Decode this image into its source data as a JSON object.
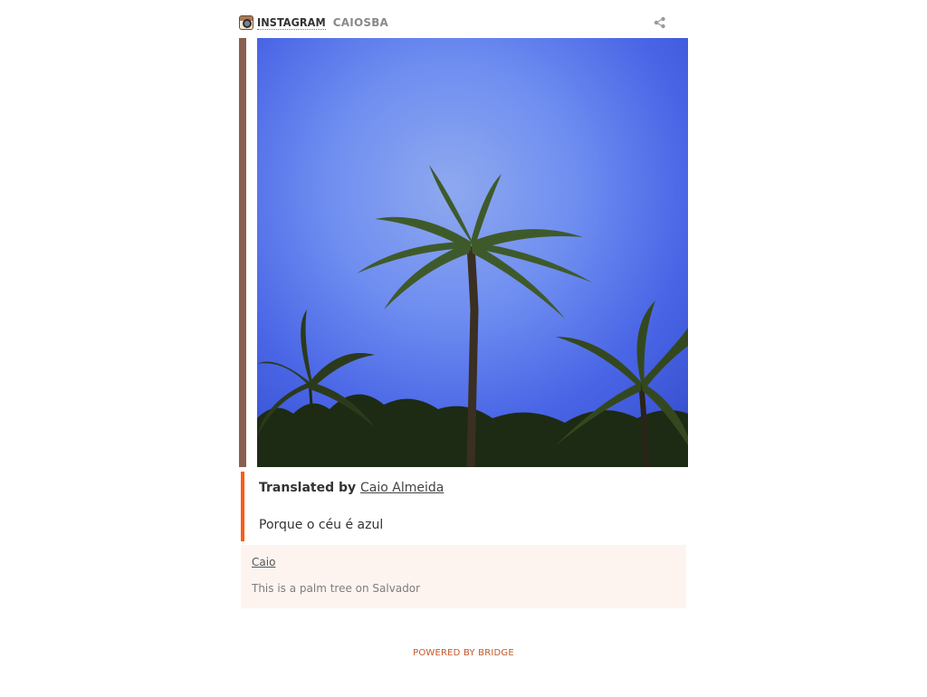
{
  "header": {
    "source_label": "INSTAGRAM",
    "username": "CAIOSBA",
    "share_icon": "share-icon"
  },
  "photo": {
    "alt": "Palm trees against a blue sky"
  },
  "translation": {
    "prefix": "Translated by",
    "translator": "Caio Almeida",
    "text": "Porque o céu é azul"
  },
  "comment": {
    "author": "Caio",
    "text": "This is a palm tree on Salvador"
  },
  "footer": {
    "powered": "POWERED BY BRIDGE"
  },
  "colors": {
    "accent_orange": "#ff5a16",
    "left_bar": "#8a5f51",
    "comment_bg": "#fdf4f0",
    "sky_blue": "#6e8df0"
  }
}
